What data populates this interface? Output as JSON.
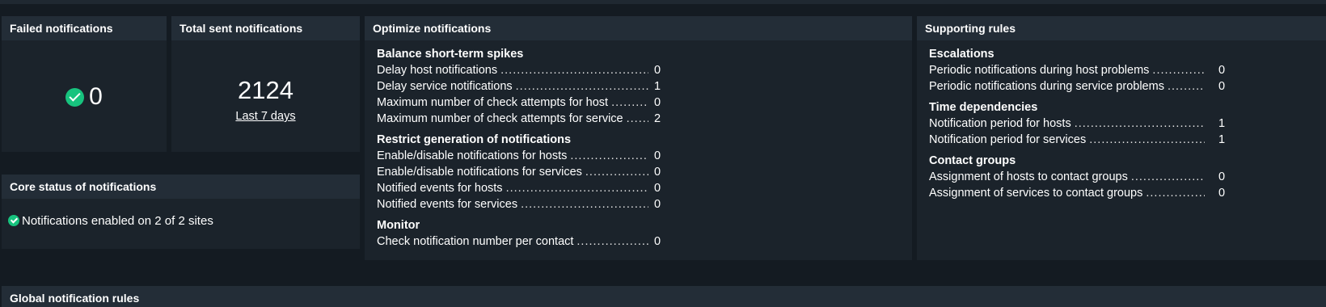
{
  "failed": {
    "title": "Failed notifications",
    "value": "0"
  },
  "total": {
    "title": "Total sent notifications",
    "value": "2124",
    "link": "Last 7 days"
  },
  "core": {
    "title": "Core status of notifications",
    "status": "Notifications enabled on 2 of 2 sites"
  },
  "optimize": {
    "title": "Optimize notifications",
    "sections": [
      {
        "title": "Balance short-term spikes",
        "rows": [
          {
            "label": "Delay host notifications",
            "value": "0"
          },
          {
            "label": "Delay service notifications",
            "value": "1"
          },
          {
            "label": "Maximum number of check attempts for host",
            "value": "0"
          },
          {
            "label": "Maximum number of check attempts for service",
            "value": "2"
          }
        ]
      },
      {
        "title": "Restrict generation of notifications",
        "rows": [
          {
            "label": "Enable/disable notifications for hosts",
            "value": "0"
          },
          {
            "label": "Enable/disable notifications for services",
            "value": "0"
          },
          {
            "label": "Notified events for hosts",
            "value": "0"
          },
          {
            "label": "Notified events for services",
            "value": "0"
          }
        ]
      },
      {
        "title": "Monitor",
        "rows": [
          {
            "label": "Check notification number per contact",
            "value": "0"
          }
        ]
      }
    ]
  },
  "supporting": {
    "title": "Supporting rules",
    "sections": [
      {
        "title": "Escalations",
        "rows": [
          {
            "label": "Periodic notifications during host problems",
            "value": "0"
          },
          {
            "label": "Periodic notifications during service problems",
            "value": "0"
          }
        ]
      },
      {
        "title": "Time dependencies",
        "rows": [
          {
            "label": "Notification period for hosts",
            "value": "1"
          },
          {
            "label": "Notification period for services",
            "value": "1"
          }
        ]
      },
      {
        "title": "Contact groups",
        "rows": [
          {
            "label": "Assignment of hosts to contact groups",
            "value": "0"
          },
          {
            "label": "Assignment of services to contact groups",
            "value": "0"
          }
        ]
      }
    ]
  },
  "global": {
    "title": "Global notification rules"
  },
  "colors": {
    "ok": "#17c37e",
    "background": "#141b22",
    "panel": "#1b232b",
    "header": "#232d37"
  }
}
